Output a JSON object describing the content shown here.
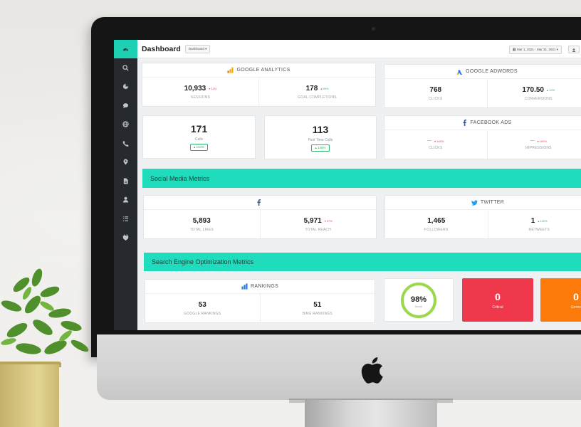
{
  "colors": {
    "accent": "#1fdcbd",
    "sidebar": "#262a2e",
    "critical": "#f0384d",
    "errors": "#fd7b0a",
    "score_ring": "#9bd84a"
  },
  "header": {
    "title": "Dashboard",
    "dropdown_label": "Dashboard ▾",
    "date_range": "Mar 1, 2021 - Mar 31, 2021 ▾"
  },
  "sidebar": {
    "icons": [
      "dashboard-icon",
      "search-icon",
      "pie-chart-icon",
      "chat-icon",
      "globe-icon",
      "phone-icon",
      "location-pin-icon",
      "document-icon",
      "user-icon",
      "list-icon",
      "plug-icon"
    ]
  },
  "google_analytics": {
    "title": "GOOGLE ANALYTICS",
    "metrics": [
      {
        "value": "10,933",
        "change": "▾ 12%",
        "label": "SESSIONS"
      },
      {
        "value": "178",
        "change": "▴ 66%",
        "label": "GOAL COMPLETIONS"
      }
    ]
  },
  "google_adwords": {
    "title": "GOOGLE ADWORDS",
    "metrics": [
      {
        "value": "768",
        "label": "CLICKS"
      },
      {
        "value": "170.50",
        "change": "▴ 12%",
        "label": "CONVERSIONS"
      }
    ]
  },
  "calls": {
    "value": "171",
    "label": "Calls",
    "change": "▴ 134%"
  },
  "first_time_calls": {
    "value": "113",
    "label": "First Time Calls",
    "change": "▴ 145%"
  },
  "facebook_ads": {
    "title": "FACEBOOK ADS",
    "metrics": [
      {
        "value": "—",
        "change": "▾ 100%",
        "label": "CLICKS"
      },
      {
        "value": "—",
        "change": "▾ 100%",
        "label": "IMPRESSIONS"
      }
    ]
  },
  "social_section": {
    "title": "Social Media Metrics"
  },
  "facebook": {
    "metrics": [
      {
        "value": "5,893",
        "label": "TOTAL LIKES"
      },
      {
        "value": "5,971",
        "change": "▾ 37%",
        "label": "TOTAL REACH"
      }
    ]
  },
  "twitter": {
    "title": "TWITTER",
    "metrics": [
      {
        "value": "1,465",
        "label": "FOLLOWERS"
      },
      {
        "value": "1",
        "change": "▴ 100%",
        "label": "RETWEETS"
      }
    ]
  },
  "seo_section": {
    "title": "Search Engine Optimization Metrics"
  },
  "rankings": {
    "title": "RANKINGS",
    "metrics": [
      {
        "value": "53",
        "label": "GOOGLE RANKINGS"
      },
      {
        "value": "51",
        "label": "BING RANKINGS"
      }
    ]
  },
  "score": {
    "value": "98%",
    "label": "Score",
    "percent": 98
  },
  "critical": {
    "value": "0",
    "label": "Critical"
  },
  "errors": {
    "value": "0",
    "label": "Errors"
  }
}
